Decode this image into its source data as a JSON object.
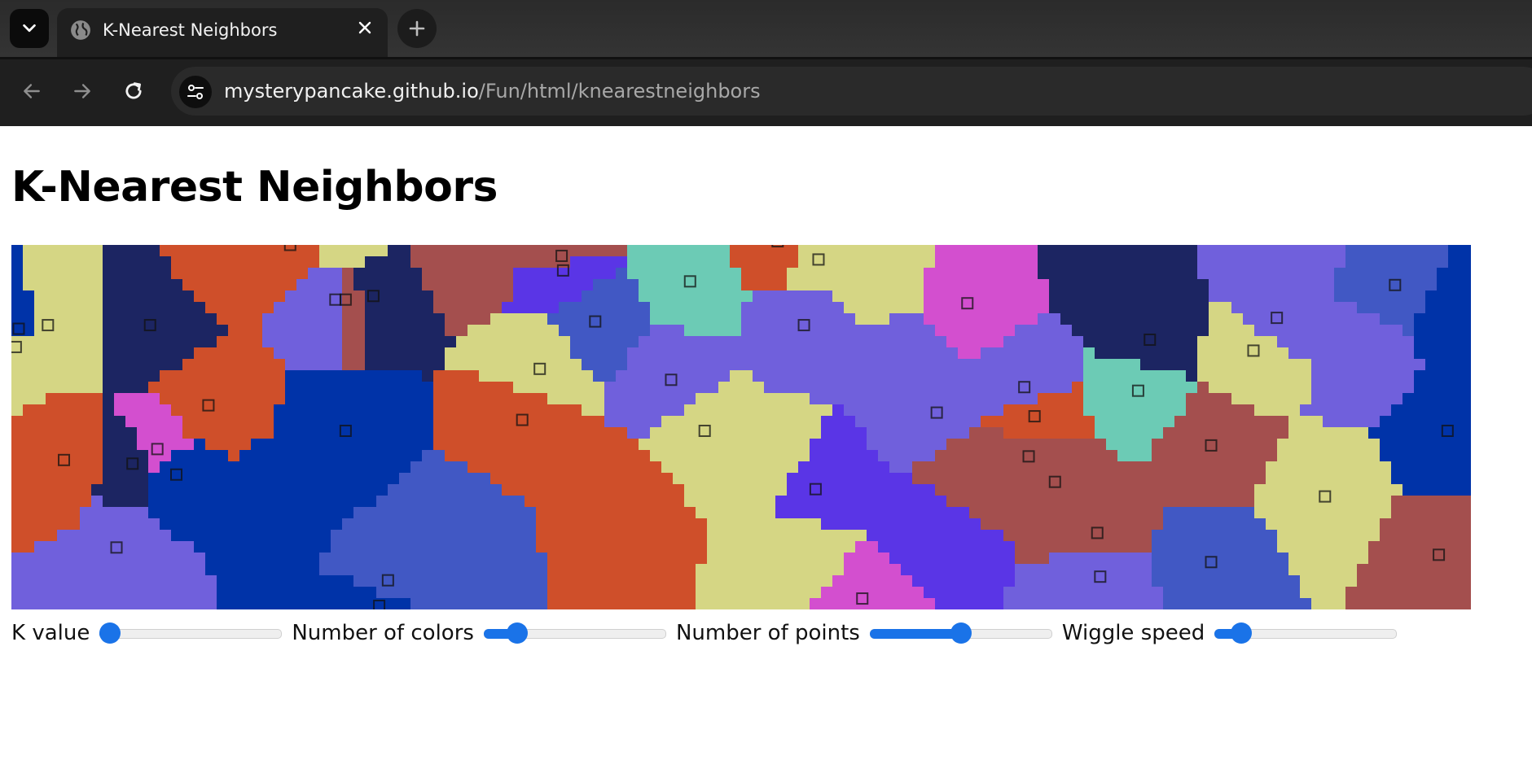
{
  "browser": {
    "tab_title": "K-Nearest Neighbors",
    "url_host": "mysterypancake.github.io",
    "url_path": "/Fun/html/knearestneighbors",
    "accent": "#1a73e8"
  },
  "page": {
    "title": "K-Nearest Neighbors"
  },
  "controls": [
    {
      "label": "K value",
      "fraction": 0.0
    },
    {
      "label": "Number of colors",
      "fraction": 0.14
    },
    {
      "label": "Number of points",
      "fraction": 0.5
    },
    {
      "label": "Wiggle speed",
      "fraction": 0.1
    }
  ],
  "palette": [
    "#1c2562",
    "#0033a8",
    "#4158c4",
    "#7060dc",
    "#5a35e6",
    "#d34fcf",
    "#cf4f2a",
    "#a44f4e",
    "#d5d684",
    "#6ccbb5"
  ],
  "points": [
    {
      "x": 0.005,
      "y": 0.23,
      "c": 1
    },
    {
      "x": 0.025,
      "y": 0.22,
      "c": 8
    },
    {
      "x": 0.003,
      "y": 0.28,
      "c": 8
    },
    {
      "x": 0.095,
      "y": 0.22,
      "c": 0
    },
    {
      "x": 0.036,
      "y": 0.59,
      "c": 6
    },
    {
      "x": 0.083,
      "y": 0.6,
      "c": 0
    },
    {
      "x": 0.1,
      "y": 0.56,
      "c": 5
    },
    {
      "x": 0.113,
      "y": 0.63,
      "c": 1
    },
    {
      "x": 0.072,
      "y": 0.83,
      "c": 3
    },
    {
      "x": 0.135,
      "y": 0.44,
      "c": 6
    },
    {
      "x": 0.191,
      "y": 0.0,
      "c": 6
    },
    {
      "x": 0.222,
      "y": 0.15,
      "c": 3
    },
    {
      "x": 0.229,
      "y": 0.15,
      "c": 7
    },
    {
      "x": 0.248,
      "y": 0.14,
      "c": 0
    },
    {
      "x": 0.229,
      "y": 0.51,
      "c": 1
    },
    {
      "x": 0.228,
      "y": -0.02,
      "c": 8
    },
    {
      "x": 0.258,
      "y": 0.92,
      "c": 2
    },
    {
      "x": 0.252,
      "y": 0.99,
      "c": 1
    },
    {
      "x": 0.35,
      "y": 0.48,
      "c": 6
    },
    {
      "x": 0.362,
      "y": 0.34,
      "c": 8
    },
    {
      "x": 0.377,
      "y": 0.03,
      "c": 7
    },
    {
      "x": 0.378,
      "y": 0.07,
      "c": 4
    },
    {
      "x": 0.4,
      "y": 0.21,
      "c": 2
    },
    {
      "x": 0.465,
      "y": 0.1,
      "c": 9
    },
    {
      "x": 0.452,
      "y": 0.37,
      "c": 3
    },
    {
      "x": 0.475,
      "y": 0.51,
      "c": 8
    },
    {
      "x": 0.525,
      "y": -0.01,
      "c": 6
    },
    {
      "x": 0.553,
      "y": 0.04,
      "c": 8
    },
    {
      "x": 0.543,
      "y": 0.22,
      "c": 3
    },
    {
      "x": 0.551,
      "y": 0.67,
      "c": 4
    },
    {
      "x": 0.583,
      "y": 0.97,
      "c": 5
    },
    {
      "x": 0.655,
      "y": 0.16,
      "c": 5
    },
    {
      "x": 0.634,
      "y": 0.46,
      "c": 3
    },
    {
      "x": 0.694,
      "y": 0.39,
      "c": 3
    },
    {
      "x": 0.701,
      "y": 0.47,
      "c": 6
    },
    {
      "x": 0.697,
      "y": 0.58,
      "c": 7
    },
    {
      "x": 0.715,
      "y": 0.65,
      "c": 7
    },
    {
      "x": 0.744,
      "y": 0.79,
      "c": 7
    },
    {
      "x": 0.746,
      "y": 0.91,
      "c": 3
    },
    {
      "x": 0.772,
      "y": 0.4,
      "c": 9
    },
    {
      "x": 0.78,
      "y": 0.26,
      "c": 0
    },
    {
      "x": 0.822,
      "y": 0.55,
      "c": 7
    },
    {
      "x": 0.822,
      "y": 0.87,
      "c": 2
    },
    {
      "x": 0.851,
      "y": 0.29,
      "c": 8
    },
    {
      "x": 0.867,
      "y": 0.2,
      "c": 3
    },
    {
      "x": 0.948,
      "y": 0.11,
      "c": 2
    },
    {
      "x": 0.9,
      "y": 0.69,
      "c": 8
    },
    {
      "x": 0.984,
      "y": 0.51,
      "c": 1
    },
    {
      "x": 0.978,
      "y": 0.85,
      "c": 7
    },
    {
      "x": 0.04,
      "y": 0.92,
      "c": 3
    },
    {
      "x": 0.3,
      "y": 0.8,
      "c": 2
    },
    {
      "x": 0.415,
      "y": 0.7,
      "c": 6
    },
    {
      "x": 0.18,
      "y": 0.7,
      "c": 1
    },
    {
      "x": 0.61,
      "y": 0.3,
      "c": 3
    },
    {
      "x": 0.595,
      "y": 0.1,
      "c": 8
    },
    {
      "x": 0.76,
      "y": 0.05,
      "c": 0
    },
    {
      "x": 0.925,
      "y": 0.3,
      "c": 3
    },
    {
      "x": 0.87,
      "y": 0.05,
      "c": 3
    },
    {
      "x": 0.99,
      "y": 0.2,
      "c": 1
    },
    {
      "x": 0.63,
      "y": 0.8,
      "c": 4
    },
    {
      "x": 0.545,
      "y": 0.85,
      "c": 8
    },
    {
      "x": 0.015,
      "y": 0.7,
      "c": 6
    },
    {
      "x": 0.15,
      "y": 0.03,
      "c": 6
    },
    {
      "x": 0.312,
      "y": 0.02,
      "c": 7
    },
    {
      "x": 0.52,
      "y": 0.6,
      "c": 8
    },
    {
      "x": 0.66,
      "y": 0.62,
      "c": 7
    }
  ],
  "visible_markers": [
    0,
    1,
    2,
    3,
    4,
    5,
    6,
    7,
    8,
    9,
    10,
    11,
    12,
    13,
    14,
    15,
    16,
    17,
    18,
    19,
    20,
    21,
    22,
    23,
    24,
    25,
    26,
    27,
    28,
    29,
    30,
    31,
    32,
    33,
    34,
    35,
    36,
    37,
    38,
    39,
    40,
    41,
    42,
    43,
    44,
    45,
    46,
    47,
    48
  ]
}
